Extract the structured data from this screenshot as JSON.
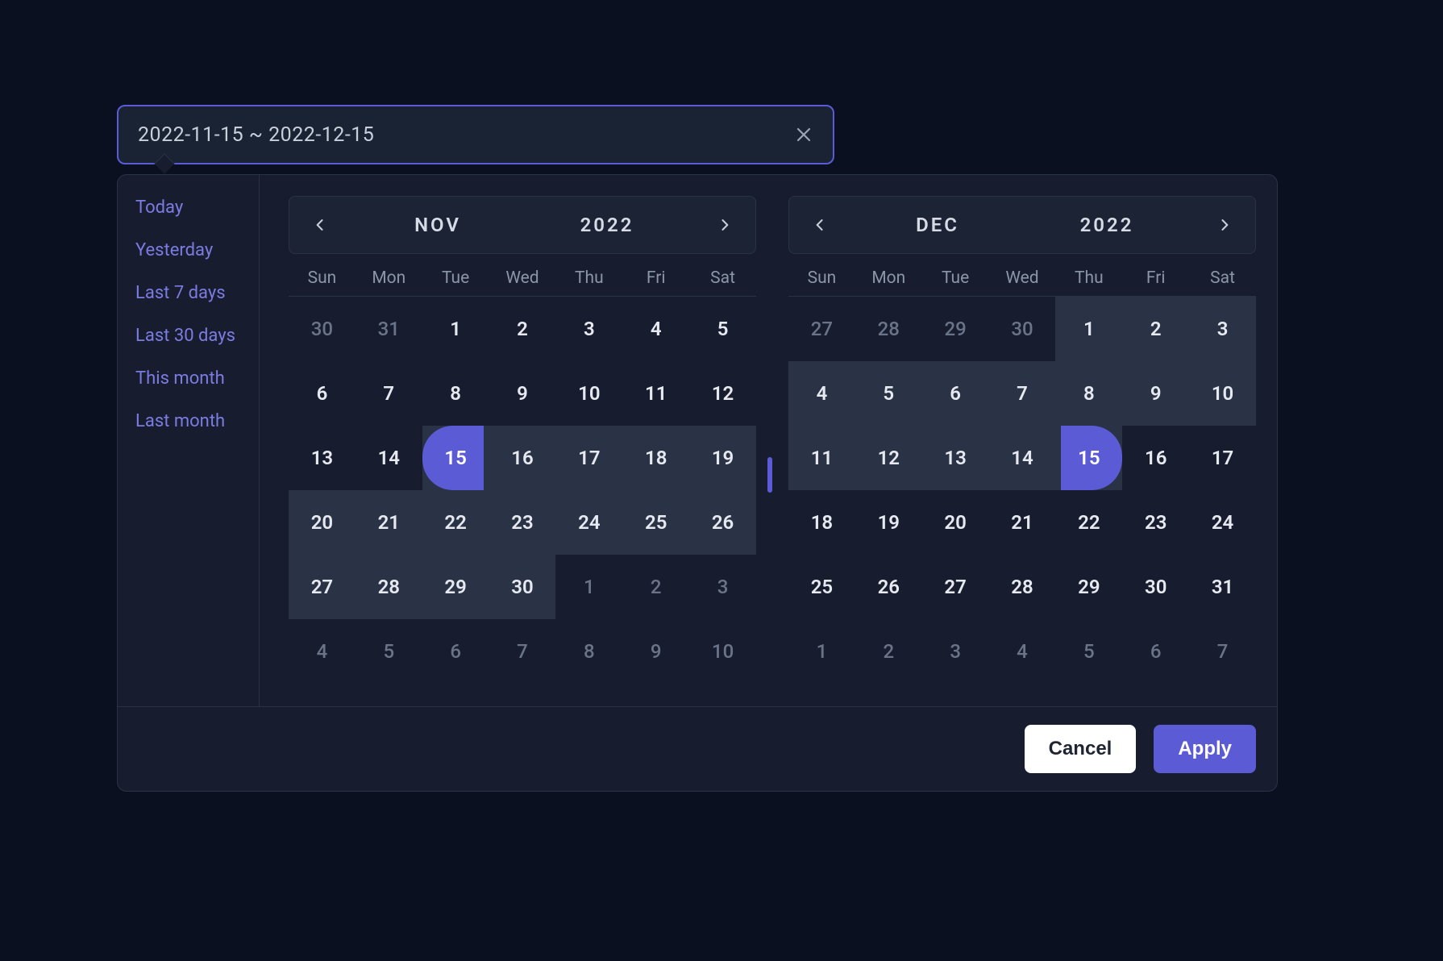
{
  "input": {
    "value": "2022-11-15 ~ 2022-12-15",
    "clear_icon_name": "close-icon"
  },
  "presets": [
    {
      "label": "Today"
    },
    {
      "label": "Yesterday"
    },
    {
      "label": "Last 7 days"
    },
    {
      "label": "Last 30 days"
    },
    {
      "label": "This month"
    },
    {
      "label": "Last month"
    }
  ],
  "weekdays": [
    "Sun",
    "Mon",
    "Tue",
    "Wed",
    "Thu",
    "Fri",
    "Sat"
  ],
  "calendars": [
    {
      "month": "NOV",
      "year": "2022",
      "days": [
        {
          "n": 30,
          "out": true
        },
        {
          "n": 31,
          "out": true
        },
        {
          "n": 1
        },
        {
          "n": 2
        },
        {
          "n": 3
        },
        {
          "n": 4
        },
        {
          "n": 5
        },
        {
          "n": 6
        },
        {
          "n": 7
        },
        {
          "n": 8
        },
        {
          "n": 9
        },
        {
          "n": 10
        },
        {
          "n": 11
        },
        {
          "n": 12
        },
        {
          "n": 13
        },
        {
          "n": 14
        },
        {
          "n": 15,
          "start": true
        },
        {
          "n": 16,
          "range": true
        },
        {
          "n": 17,
          "range": true
        },
        {
          "n": 18,
          "range": true
        },
        {
          "n": 19,
          "range": true
        },
        {
          "n": 20,
          "range": true
        },
        {
          "n": 21,
          "range": true
        },
        {
          "n": 22,
          "range": true
        },
        {
          "n": 23,
          "range": true
        },
        {
          "n": 24,
          "range": true
        },
        {
          "n": 25,
          "range": true
        },
        {
          "n": 26,
          "range": true
        },
        {
          "n": 27,
          "range": true
        },
        {
          "n": 28,
          "range": true
        },
        {
          "n": 29,
          "range": true
        },
        {
          "n": 30,
          "range": true
        },
        {
          "n": 1,
          "out": true
        },
        {
          "n": 2,
          "out": true
        },
        {
          "n": 3,
          "out": true
        },
        {
          "n": 4,
          "out": true
        },
        {
          "n": 5,
          "out": true
        },
        {
          "n": 6,
          "out": true
        },
        {
          "n": 7,
          "out": true
        },
        {
          "n": 8,
          "out": true
        },
        {
          "n": 9,
          "out": true
        },
        {
          "n": 10,
          "out": true
        }
      ]
    },
    {
      "month": "DEC",
      "year": "2022",
      "days": [
        {
          "n": 27,
          "out": true
        },
        {
          "n": 28,
          "out": true
        },
        {
          "n": 29,
          "out": true
        },
        {
          "n": 30,
          "out": true
        },
        {
          "n": 1,
          "range": true
        },
        {
          "n": 2,
          "range": true
        },
        {
          "n": 3,
          "range": true
        },
        {
          "n": 4,
          "range": true
        },
        {
          "n": 5,
          "range": true
        },
        {
          "n": 6,
          "range": true
        },
        {
          "n": 7,
          "range": true
        },
        {
          "n": 8,
          "range": true
        },
        {
          "n": 9,
          "range": true
        },
        {
          "n": 10,
          "range": true
        },
        {
          "n": 11,
          "range": true
        },
        {
          "n": 12,
          "range": true
        },
        {
          "n": 13,
          "range": true
        },
        {
          "n": 14,
          "range": true
        },
        {
          "n": 15,
          "end": true
        },
        {
          "n": 16
        },
        {
          "n": 17
        },
        {
          "n": 18
        },
        {
          "n": 19
        },
        {
          "n": 20
        },
        {
          "n": 21
        },
        {
          "n": 22
        },
        {
          "n": 23
        },
        {
          "n": 24
        },
        {
          "n": 25
        },
        {
          "n": 26
        },
        {
          "n": 27
        },
        {
          "n": 28
        },
        {
          "n": 29
        },
        {
          "n": 30
        },
        {
          "n": 31
        },
        {
          "n": 1,
          "out": true
        },
        {
          "n": 2,
          "out": true
        },
        {
          "n": 3,
          "out": true
        },
        {
          "n": 4,
          "out": true
        },
        {
          "n": 5,
          "out": true
        },
        {
          "n": 6,
          "out": true
        },
        {
          "n": 7,
          "out": true
        }
      ]
    }
  ],
  "footer": {
    "cancel": "Cancel",
    "apply": "Apply"
  }
}
